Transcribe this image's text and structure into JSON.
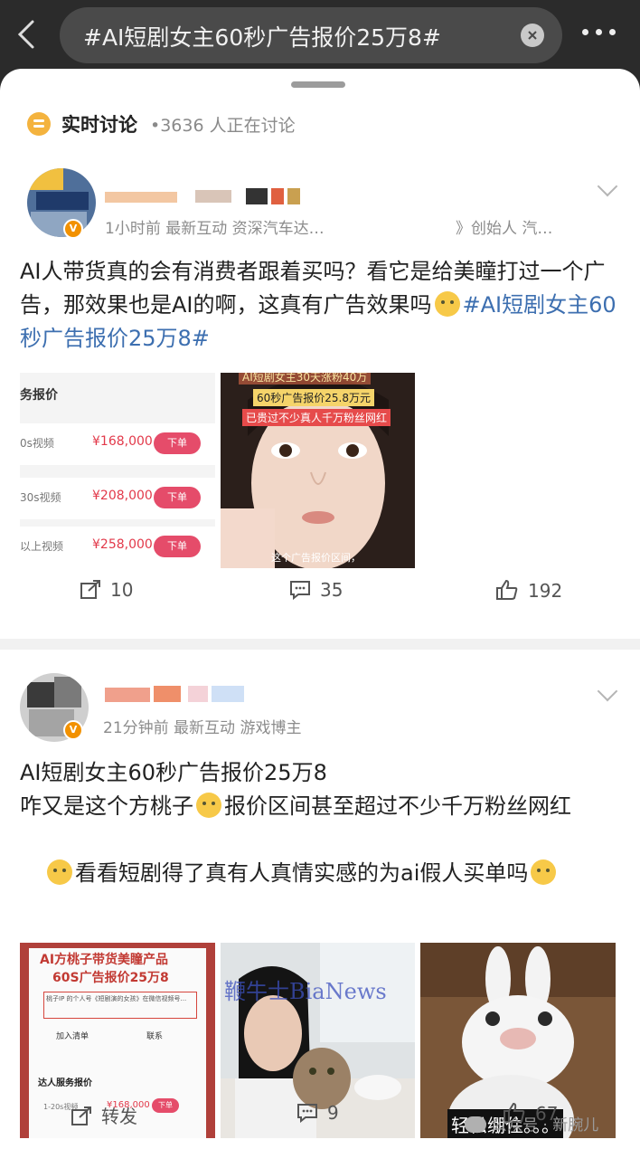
{
  "header": {
    "search_text": "#AI短剧女主60秒广告报价25万8#"
  },
  "discussion": {
    "title": "实时讨论",
    "count": "•3636 人正在讨论"
  },
  "posts": [
    {
      "meta": "1小时前  最新互动  资深汽车达…",
      "meta_tail": "》创始人 汽…",
      "text_a": "AI人带货真的会有消费者跟着买吗？看它是给美瞳打过一个广告，那效果也是AI的啊，这真有广告效果吗",
      "topic": "#AI短剧女主60秒广告报价25万8#",
      "images": {
        "price_title": "务报价",
        "rows": [
          {
            "label": "0s视频",
            "price": "¥168,000",
            "btn": "下单"
          },
          {
            "label": "30s视频",
            "price": "¥208,000",
            "btn": "下单"
          },
          {
            "label": "以上视频",
            "price": "¥258,000",
            "btn": "下单"
          }
        ],
        "face_caption_1": "AI短剧女主30天涨粉40万",
        "face_caption_2": "60秒广告报价25.8万元",
        "face_caption_3": "已贵过不少真人千万粉丝网红",
        "face_sub": "这个广告报价区间，"
      },
      "actions": {
        "repost": "10",
        "comment": "35",
        "like": "192"
      }
    },
    {
      "meta": "21分钟前  最新互动  游戏博主",
      "line1": "AI短剧女主60秒广告报价25万8",
      "line2a": "咋又是这个方桃子",
      "line2b": "报价区间甚至超过不少千万粉丝网红",
      "line2c": "看看短剧得了真有人真情实感的为ai假人买单吗",
      "images": {
        "card_title_1": "AI方桃子带货美瞳产品",
        "card_title_2": "60S广告报价25万8",
        "card_intro": "桃子IP 的个人号《短剧演的女孩》在微信视频号...",
        "card_add": "加入清单",
        "card_contact": "联系",
        "card_section": "达人服务报价",
        "card_row_label": "1-20s视频",
        "card_row_price": "¥168,000",
        "card_row_btn": "下单",
        "watermark": "鞭牛士BiaNews",
        "bunny_caption": "轻松绷住。。。"
      },
      "actions": {
        "repost": "转发",
        "comment": "9",
        "like": "67"
      }
    }
  ],
  "watermark": "公众号 · 新腕儿"
}
